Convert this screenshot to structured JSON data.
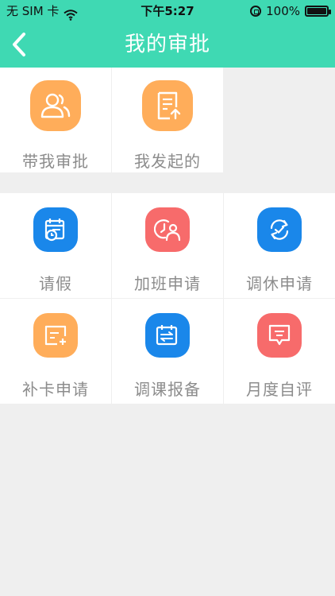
{
  "status": {
    "carrier": "无 SIM 卡",
    "time": "下午5:27",
    "battery_percent": "100%",
    "battery_level": 1.0
  },
  "nav": {
    "title": "我的审批"
  },
  "section1": {
    "items": [
      {
        "label": "带我审批",
        "icon": "people-icon",
        "color": "#ffad5a"
      },
      {
        "label": "我发起的",
        "icon": "document-upload-icon",
        "color": "#ffad5a"
      }
    ]
  },
  "section2": {
    "items": [
      {
        "label": "请假",
        "icon": "calendar-clock-icon",
        "color": "#1a87ea"
      },
      {
        "label": "加班申请",
        "icon": "clock-person-icon",
        "color": "#f76b6b"
      },
      {
        "label": "调休申请",
        "icon": "refresh-check-icon",
        "color": "#1a87ea"
      },
      {
        "label": "补卡申请",
        "icon": "card-plus-icon",
        "color": "#ffad5a"
      },
      {
        "label": "调课报备",
        "icon": "calendar-swap-icon",
        "color": "#1a87ea"
      },
      {
        "label": "月度自评",
        "icon": "message-icon",
        "color": "#f76b6b"
      }
    ]
  }
}
